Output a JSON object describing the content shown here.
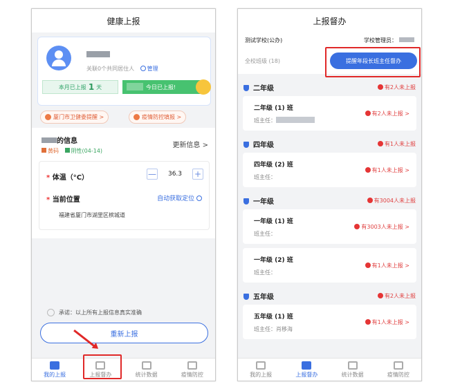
{
  "left": {
    "title": "健康上报",
    "cohabit_text": "关联0个共同居住人",
    "manage_label": "管理",
    "month_reported_prefix": "本月已上报",
    "month_reported_count": "1",
    "month_reported_suffix": "天",
    "today_reported": "今日已上报!",
    "notice1": "厦门市卫健委提醒 >",
    "notice2": "疫情防控填报 >",
    "info_title_suffix": "的信息",
    "update_info": "更新信息 >",
    "tag_health": "黄码",
    "tag_test": "阴性(04-14)",
    "temp_label": "体温（°C）",
    "temp_value": "36.3",
    "minus": "—",
    "plus": "+",
    "location_label": "当前位置",
    "auto_locate": "自动获取定位",
    "address": "福建省厦门市湖里区槟城道",
    "promise": "承诺：以上所有上报信息真实准确",
    "resubmit": "重新上报",
    "tabs": [
      "我的上报",
      "上报督办",
      "统计数据",
      "疫情防控"
    ]
  },
  "right": {
    "title": "上报督办",
    "school": "测试学校(公办)",
    "admin_label": "学校管理员：",
    "filter": "全校班级 (18)",
    "remind_button": "提醒年段长班主任督办",
    "grades": [
      {
        "name": "二年级",
        "alert": "有2人未上报",
        "classes": [
          {
            "name": "二年级 (1) 班",
            "teacher": "班主任：",
            "alert": "有2人未上报 >"
          }
        ]
      },
      {
        "name": "四年级",
        "alert": "有1人未上报",
        "classes": [
          {
            "name": "四年级 (2) 班",
            "teacher": "班主任：",
            "alert": "有1人未上报 >"
          }
        ]
      },
      {
        "name": "一年级",
        "alert": "有3004人未上报",
        "classes": [
          {
            "name": "一年级 (1) 班",
            "teacher": "班主任：",
            "alert": "有3003人未上报 >"
          },
          {
            "name": "一年级 (2) 班",
            "teacher": "班主任：",
            "alert": "有1人未上报 >"
          }
        ]
      },
      {
        "name": "五年级",
        "alert": "有2人未上报",
        "classes": [
          {
            "name": "五年级 (1) 班",
            "teacher": "班主任：肖移海",
            "alert": "有1人未上报 >"
          }
        ]
      }
    ],
    "tabs": [
      "我的上报",
      "上报督办",
      "统计数据",
      "疫情防控"
    ]
  }
}
